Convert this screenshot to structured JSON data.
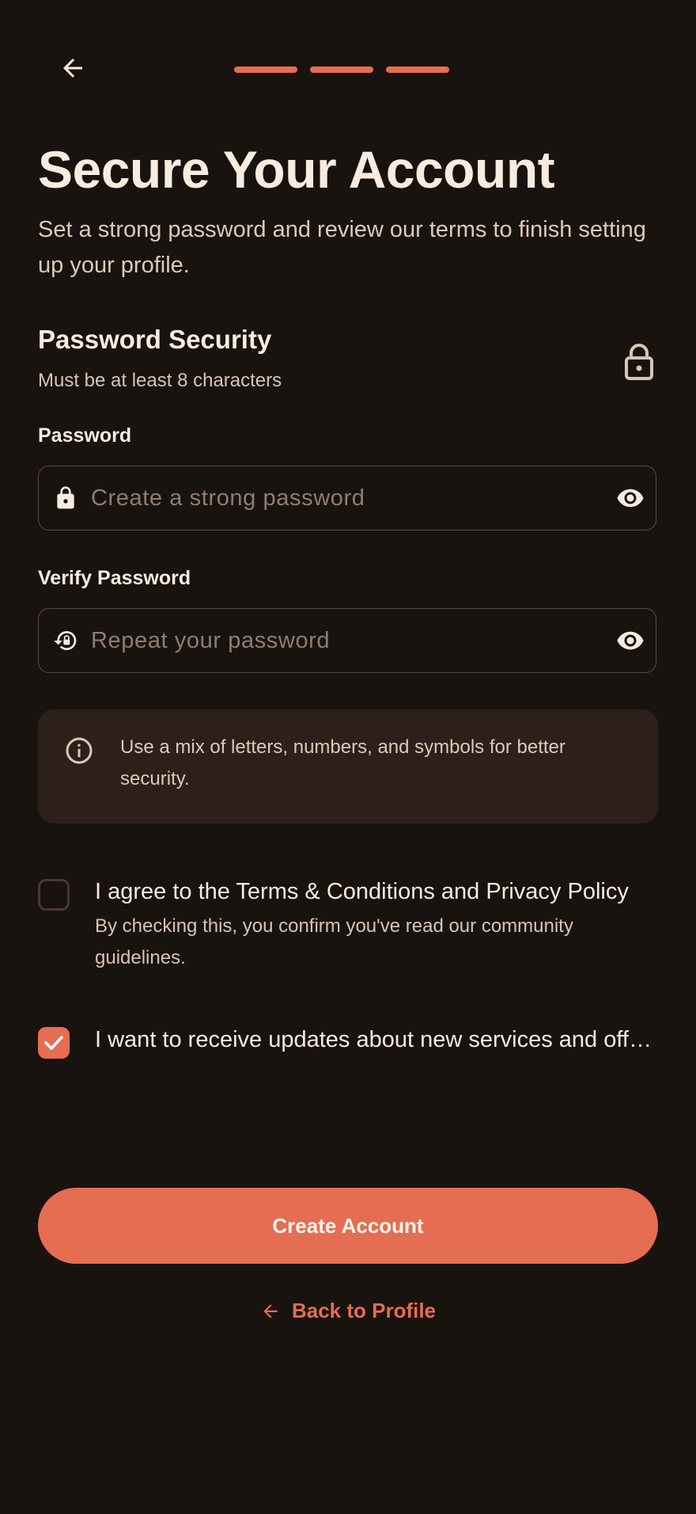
{
  "header": {
    "back_icon": "arrow-left-icon",
    "progress_steps_total": 3,
    "progress_steps_completed": 3,
    "accent_color": "#e56d51"
  },
  "title": "Secure Your Account",
  "subtitle": "Set a strong password and review our terms to finish setting up your profile.",
  "security": {
    "title": "Password Security",
    "subtitle": "Must be at least 8 characters",
    "icon": "lock-outline-icon"
  },
  "password": {
    "label": "Password",
    "placeholder": "Create a strong password",
    "value": "",
    "lead_icon": "lock-icon",
    "toggle_icon": "eye-icon"
  },
  "verify": {
    "label": "Verify Password",
    "placeholder": "Repeat your password",
    "value": "",
    "lead_icon": "lock-reset-icon",
    "toggle_icon": "eye-icon"
  },
  "tip": {
    "icon": "info-icon",
    "text": "Use a mix of letters, numbers, and symbols for better security."
  },
  "terms": {
    "label": "I agree to the Terms & Conditions and Privacy Policy",
    "description": "By checking this, you confirm you've read our community guidelines.",
    "checked": false
  },
  "updates": {
    "label": "I want to receive updates about new services and offers",
    "checked": true
  },
  "actions": {
    "primary_label": "Create Account",
    "back_label": "Back to Profile"
  }
}
